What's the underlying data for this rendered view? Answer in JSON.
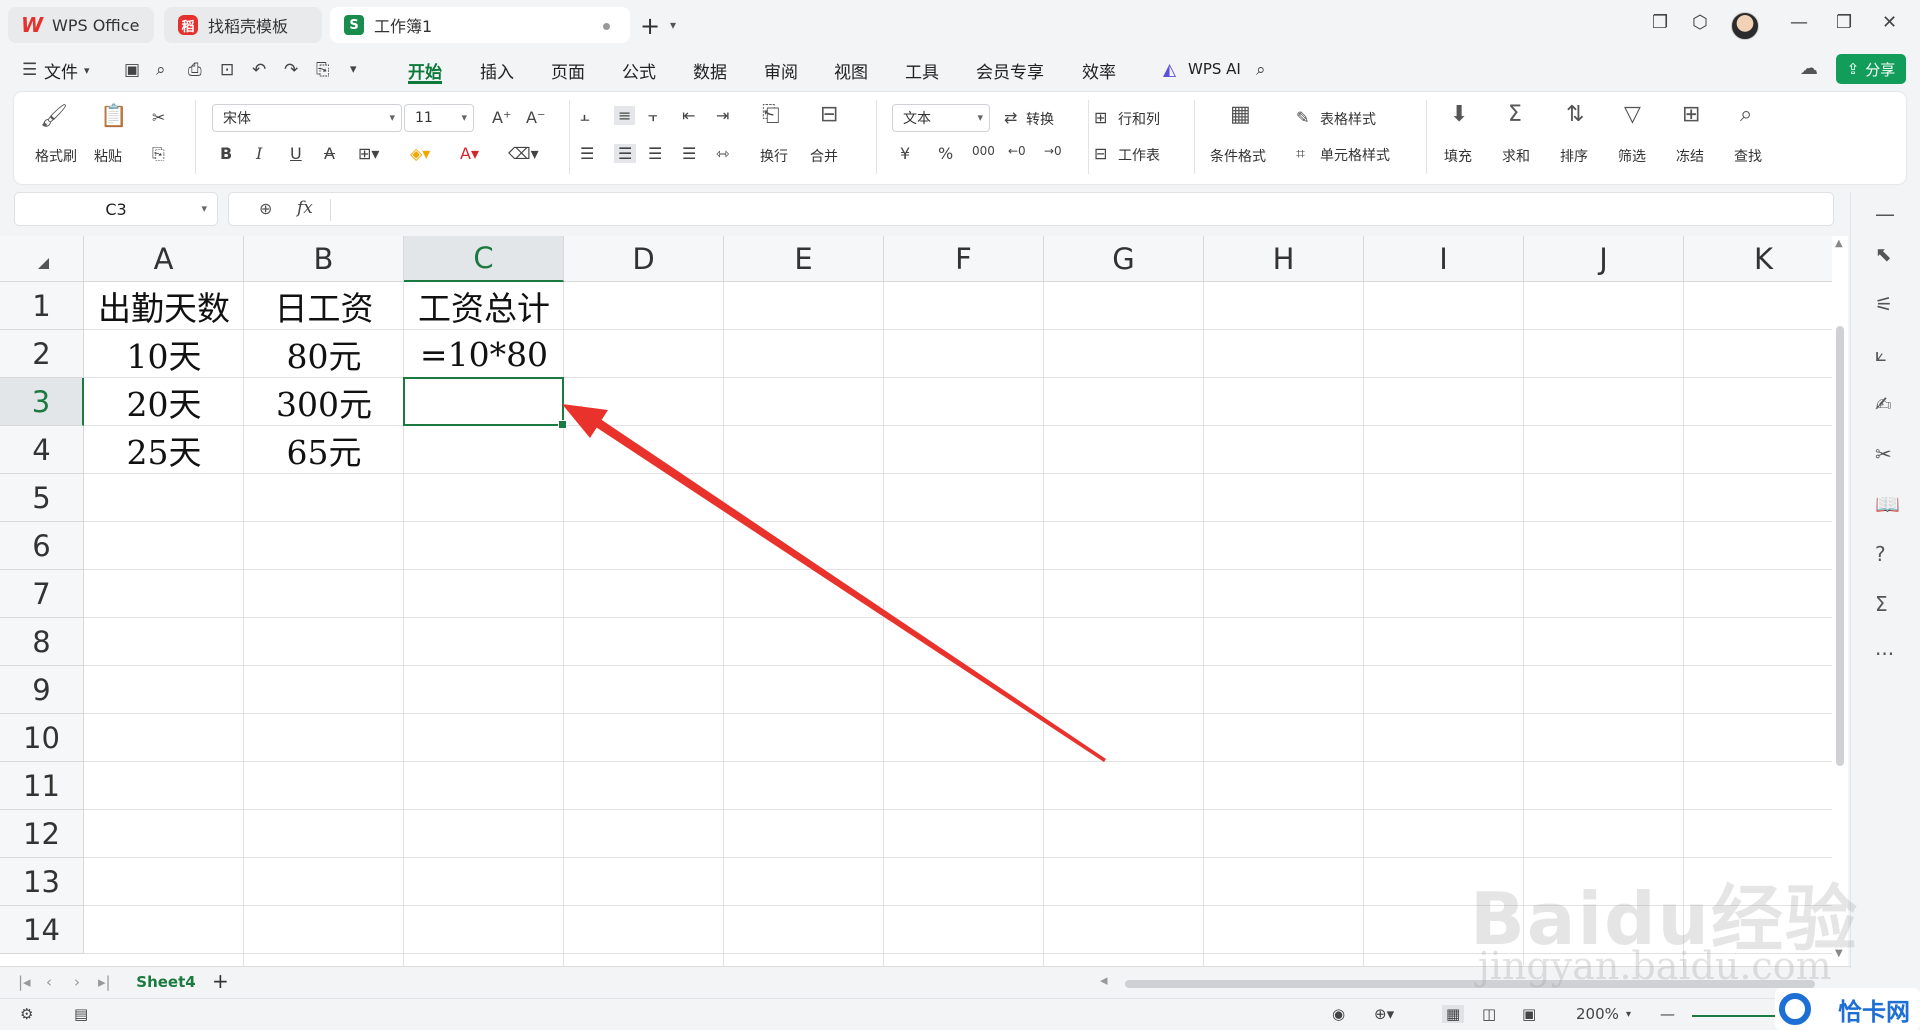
{
  "titlebar": {
    "tabs": [
      {
        "label": "WPS Office",
        "logo": "W"
      },
      {
        "label": "找稻壳模板",
        "logo": "稻"
      },
      {
        "label": "工作簿1",
        "logo": "S"
      }
    ],
    "new_tab": "+"
  },
  "menubar": {
    "file": "文件",
    "tabs": [
      "开始",
      "插入",
      "页面",
      "公式",
      "数据",
      "审阅",
      "视图",
      "工具",
      "会员专享",
      "效率"
    ],
    "active_tab": "开始",
    "wps_ai": "WPS AI",
    "share": "分享"
  },
  "ribbon": {
    "format_painter": "格式刷",
    "paste": "粘贴",
    "font_name": "宋体",
    "font_size": "11",
    "number_format": "文本",
    "convert": "转换",
    "wrap": "换行",
    "merge": "合并",
    "row_col": "行和列",
    "worksheet": "工作表",
    "cond_format": "条件格式",
    "table_style": "表格样式",
    "cell_style": "单元格样式",
    "fill": "填充",
    "sum": "求和",
    "sort": "排序",
    "filter": "筛选",
    "freeze": "冻结",
    "find": "查找",
    "bold": "B",
    "italic": "I",
    "underline": "U",
    "strike": "A",
    "percent": "%",
    "yuan": "¥"
  },
  "formula_bar": {
    "name_box": "C3",
    "fx": "fx",
    "value": ""
  },
  "sheet": {
    "columns": [
      "A",
      "B",
      "C",
      "D",
      "E",
      "F",
      "G",
      "H",
      "I",
      "J",
      "K"
    ],
    "rows": [
      "1",
      "2",
      "3",
      "4",
      "5",
      "6",
      "7",
      "8",
      "9",
      "10",
      "11",
      "12",
      "13",
      "14"
    ],
    "selected_col": "C",
    "selected_row": "3",
    "cells": {
      "A1": "出勤天数",
      "B1": "日工资",
      "C1": "工资总计",
      "A2": "10天",
      "B2": "80元",
      "C2": "=10*80",
      "A3": "20天",
      "B3": "300元",
      "C3": "",
      "A4": "25天",
      "B4": "65元"
    }
  },
  "sheet_tabs": {
    "tabs": [
      "Sheet4"
    ],
    "add": "+"
  },
  "status": {
    "zoom": "200%"
  },
  "watermark": {
    "baidu": "Baidu经验",
    "url": "jingyan.baidu.com",
    "qiaka": "恰卡网"
  },
  "colors": {
    "accent": "#0c7a3a",
    "share_button": "#129d5b",
    "selection": "#1b7a3f",
    "annotation_arrow": "#e8322b"
  }
}
